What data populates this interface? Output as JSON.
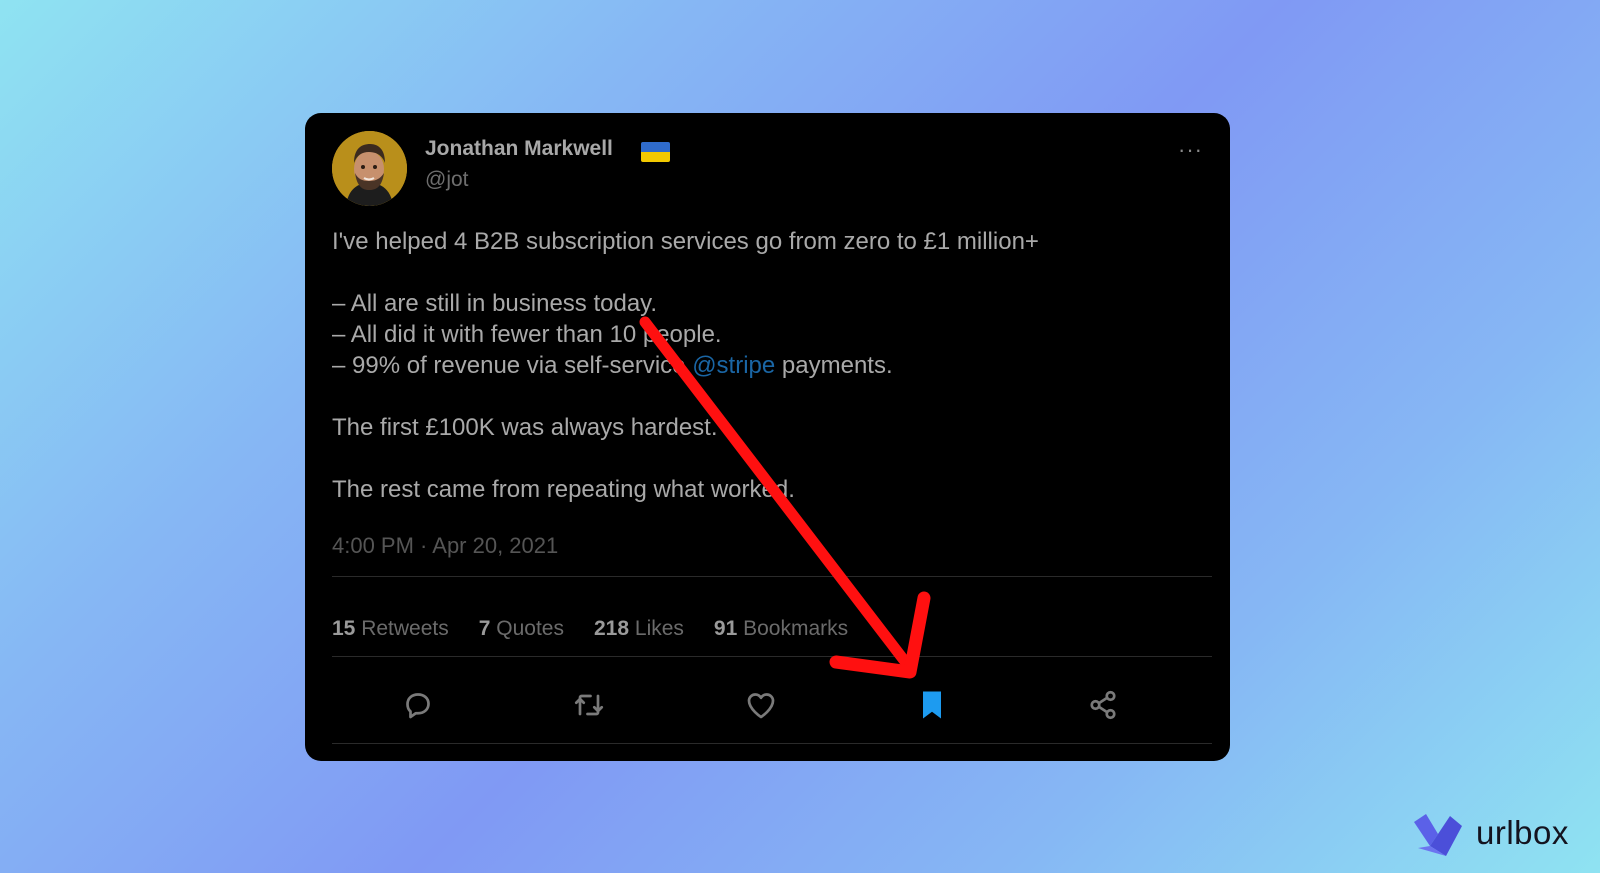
{
  "tweet": {
    "author_name": "Jonathan Markwell",
    "author_handle": "@jot",
    "more_label": "···",
    "lines": {
      "l1": "I've helped 4 B2B subscription services go from zero to £1 million+",
      "l2": "– All are still in business today.",
      "l3": "– All did it with fewer than 10 people.",
      "l4_prefix": "– 99% of revenue via self-service ",
      "l4_mention": "@stripe",
      "l4_suffix": " payments.",
      "l5": "The first £100K was always hardest.",
      "l6": "The rest came from repeating what worked."
    },
    "timestamp": "4:00 PM · Apr 20, 2021",
    "stats": {
      "retweets_count": "15",
      "retweets_label": "Retweets",
      "quotes_count": "7",
      "quotes_label": "Quotes",
      "likes_count": "218",
      "likes_label": "Likes",
      "bookmarks_count": "91",
      "bookmarks_label": "Bookmarks"
    }
  },
  "icons": {
    "reply": "reply-icon",
    "retweet": "retweet-icon",
    "like": "heart-icon",
    "bookmark": "bookmark-icon",
    "share": "share-icon",
    "flag": "ukraine-flag-icon"
  },
  "colors": {
    "card_bg": "#000000",
    "mention": "#1a66a5",
    "bookmark_active": "#1d9bf0",
    "annotation_arrow": "#ff1010"
  },
  "brand": {
    "name": "urlbox"
  }
}
